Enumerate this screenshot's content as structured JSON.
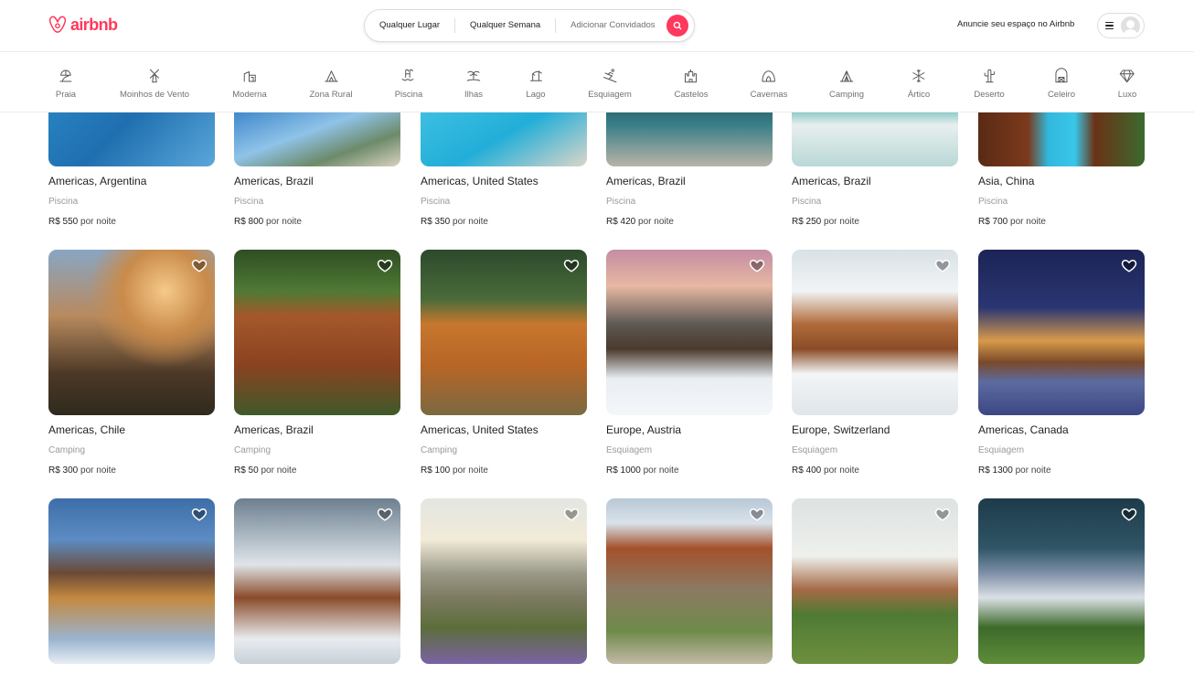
{
  "brand": {
    "name": "airbnb",
    "color": "#ff385c"
  },
  "search": {
    "where_label": "Qualquer Lugar",
    "when_label": "Qualquer Semana",
    "guests_label": "Adicionar Convidados",
    "search_icon": "search-icon"
  },
  "header": {
    "host_link": "Anuncie seu espaço no Airbnb",
    "menu_icon": "hamburger-icon",
    "avatar_icon": "user-avatar-icon"
  },
  "categories": [
    {
      "label": "Praia",
      "icon": "beach-icon"
    },
    {
      "label": "Moinhos de Vento",
      "icon": "windmill-icon"
    },
    {
      "label": "Moderna",
      "icon": "modern-house-icon"
    },
    {
      "label": "Zona Rural",
      "icon": "countryside-icon"
    },
    {
      "label": "Piscina",
      "icon": "pool-icon"
    },
    {
      "label": "Ilhas",
      "icon": "island-icon"
    },
    {
      "label": "Lago",
      "icon": "lake-icon"
    },
    {
      "label": "Esquiagem",
      "icon": "skiing-icon"
    },
    {
      "label": "Castelos",
      "icon": "castle-icon"
    },
    {
      "label": "Cavernas",
      "icon": "cave-icon"
    },
    {
      "label": "Camping",
      "icon": "camping-icon"
    },
    {
      "label": "Ártico",
      "icon": "snowflake-icon"
    },
    {
      "label": "Deserto",
      "icon": "cactus-icon"
    },
    {
      "label": "Celeiro",
      "icon": "barn-icon"
    },
    {
      "label": "Luxo",
      "icon": "diamond-icon"
    }
  ],
  "listings": [
    {
      "location": "Americas, Argentina",
      "category": "Piscina",
      "price": "R$ 550",
      "per": "por noite"
    },
    {
      "location": "Americas, Brazil",
      "category": "Piscina",
      "price": "R$ 800",
      "per": "por noite"
    },
    {
      "location": "Americas, United States",
      "category": "Piscina",
      "price": "R$ 350",
      "per": "por noite"
    },
    {
      "location": "Americas, Brazil",
      "category": "Piscina",
      "price": "R$ 420",
      "per": "por noite"
    },
    {
      "location": "Americas, Brazil",
      "category": "Piscina",
      "price": "R$ 250",
      "per": "por noite"
    },
    {
      "location": "Asia, China",
      "category": "Piscina",
      "price": "R$ 700",
      "per": "por noite"
    },
    {
      "location": "Americas, Chile",
      "category": "Camping",
      "price": "R$ 300",
      "per": "por noite"
    },
    {
      "location": "Americas, Brazil",
      "category": "Camping",
      "price": "R$ 50",
      "per": "por noite"
    },
    {
      "location": "Americas, United States",
      "category": "Camping",
      "price": "R$ 100",
      "per": "por noite"
    },
    {
      "location": "Europe, Austria",
      "category": "Esquiagem",
      "price": "R$ 1000",
      "per": "por noite"
    },
    {
      "location": "Europe, Switzerland",
      "category": "Esquiagem",
      "price": "R$ 400",
      "per": "por noite"
    },
    {
      "location": "Americas, Canada",
      "category": "Esquiagem",
      "price": "R$ 1300",
      "per": "por noite"
    }
  ]
}
